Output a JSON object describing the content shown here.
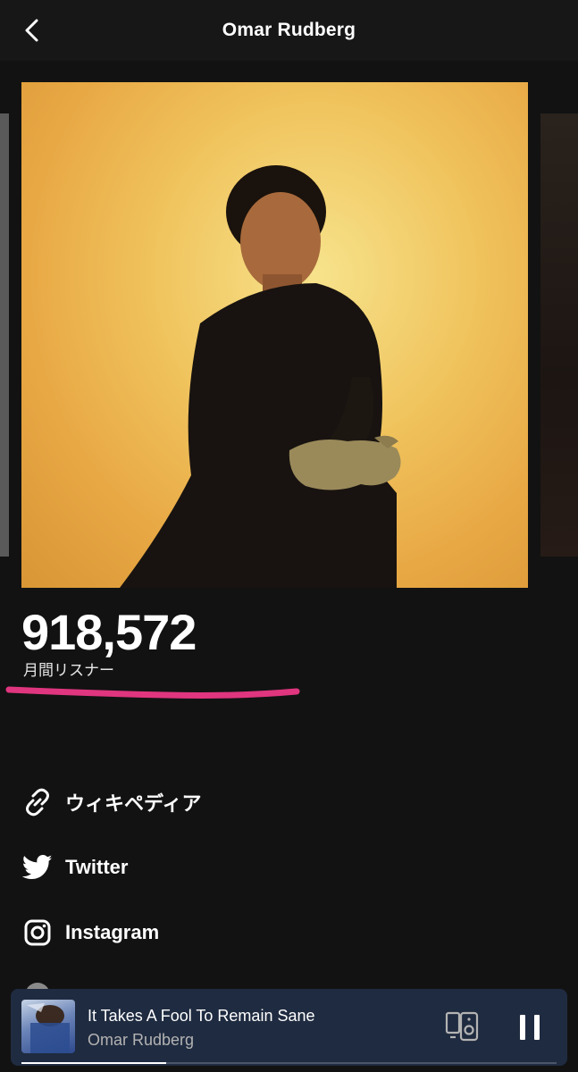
{
  "header": {
    "title": "Omar Rudberg",
    "back_icon": "chevron-left-icon"
  },
  "stats": {
    "monthly_listeners": "918,572",
    "monthly_listeners_label": "月間リスナー",
    "highlight_color": "#e0357f"
  },
  "links": [
    {
      "label": "ウィキペディア",
      "icon": "link-icon"
    },
    {
      "label": "Twitter",
      "icon": "twitter-icon"
    },
    {
      "label": "Instagram",
      "icon": "instagram-icon"
    }
  ],
  "now_playing": {
    "track": "It Takes A Fool To Remain Sane",
    "artist": "Omar Rudberg",
    "progress": 0.27,
    "device_icon": "speaker-device-icon",
    "control_icon": "pause-icon",
    "background_color": "#1f2b40"
  }
}
